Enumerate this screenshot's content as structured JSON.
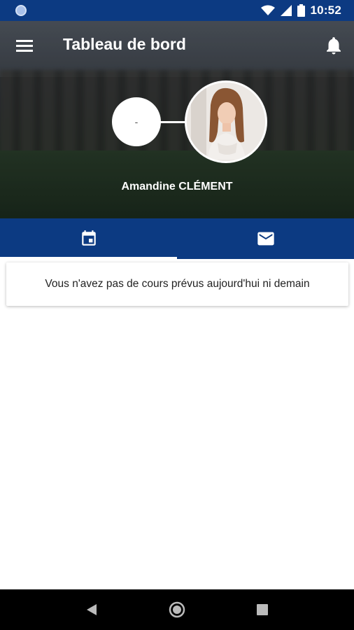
{
  "status_bar": {
    "time": "10:52"
  },
  "header": {
    "title": "Tableau de bord"
  },
  "profile": {
    "placeholder_symbol": "-",
    "name": "Amandine CLÉMENT"
  },
  "tabs": [
    {
      "icon": "calendar-icon",
      "selected": true
    },
    {
      "icon": "mail-icon",
      "selected": false
    }
  ],
  "content": {
    "empty_message": "Vous n'avez pas de cours prévus aujourd'hui ni demain"
  },
  "colors": {
    "primary": "#0c3a82",
    "on_primary": "#ffffff"
  }
}
